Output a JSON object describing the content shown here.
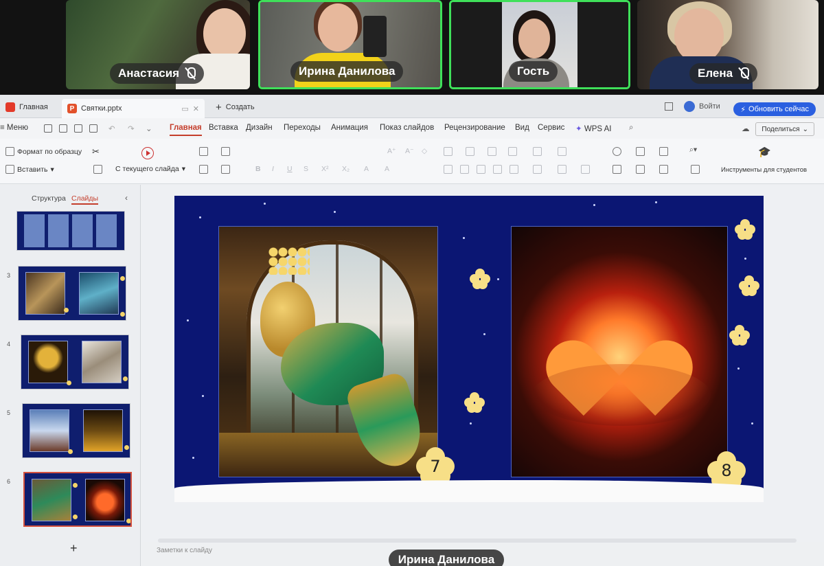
{
  "participants": [
    {
      "name": "Анастасия",
      "muted": true,
      "active": false
    },
    {
      "name": "Ирина Данилова",
      "muted": false,
      "active": true
    },
    {
      "name": "Гость",
      "muted": false,
      "active": true
    },
    {
      "name": "Елена",
      "muted": true,
      "active": false
    }
  ],
  "speaker_label": "Ирина Данилова",
  "titlebar": {
    "home_tab": "Главная",
    "file_tab": "Святки.pptx",
    "new_tab": "Создать",
    "login": "Войти",
    "update_button": "Обновить сейчас"
  },
  "menu": {
    "menu_label": "Меню",
    "tabs": [
      "Главная",
      "Вставка",
      "Дизайн",
      "Переходы",
      "Анимация",
      "Показ слайдов",
      "Рецензирование",
      "Вид",
      "Сервис",
      "WPS AI"
    ],
    "active_tab": "Главная",
    "share": "Поделиться"
  },
  "ribbon": {
    "format_painter": "Формат по образцу",
    "paste": "Вставить",
    "from_current": "С текущего слайда",
    "student_tools": "Инструменты для студентов"
  },
  "leftpane": {
    "tab_structure": "Структура",
    "tab_slides": "Слайды",
    "slide_numbers": [
      "3",
      "4",
      "5",
      "6"
    ],
    "add": "+"
  },
  "slide": {
    "left_number": "7",
    "right_number": "8"
  },
  "notes_placeholder": "Заметки к слайду",
  "colors": {
    "slide_bg": "#0b1673",
    "accent_red": "#c43d2b",
    "active_border": "#3fe05a",
    "update_blue": "#2a5fe0",
    "star_yellow": "#f7df87"
  }
}
